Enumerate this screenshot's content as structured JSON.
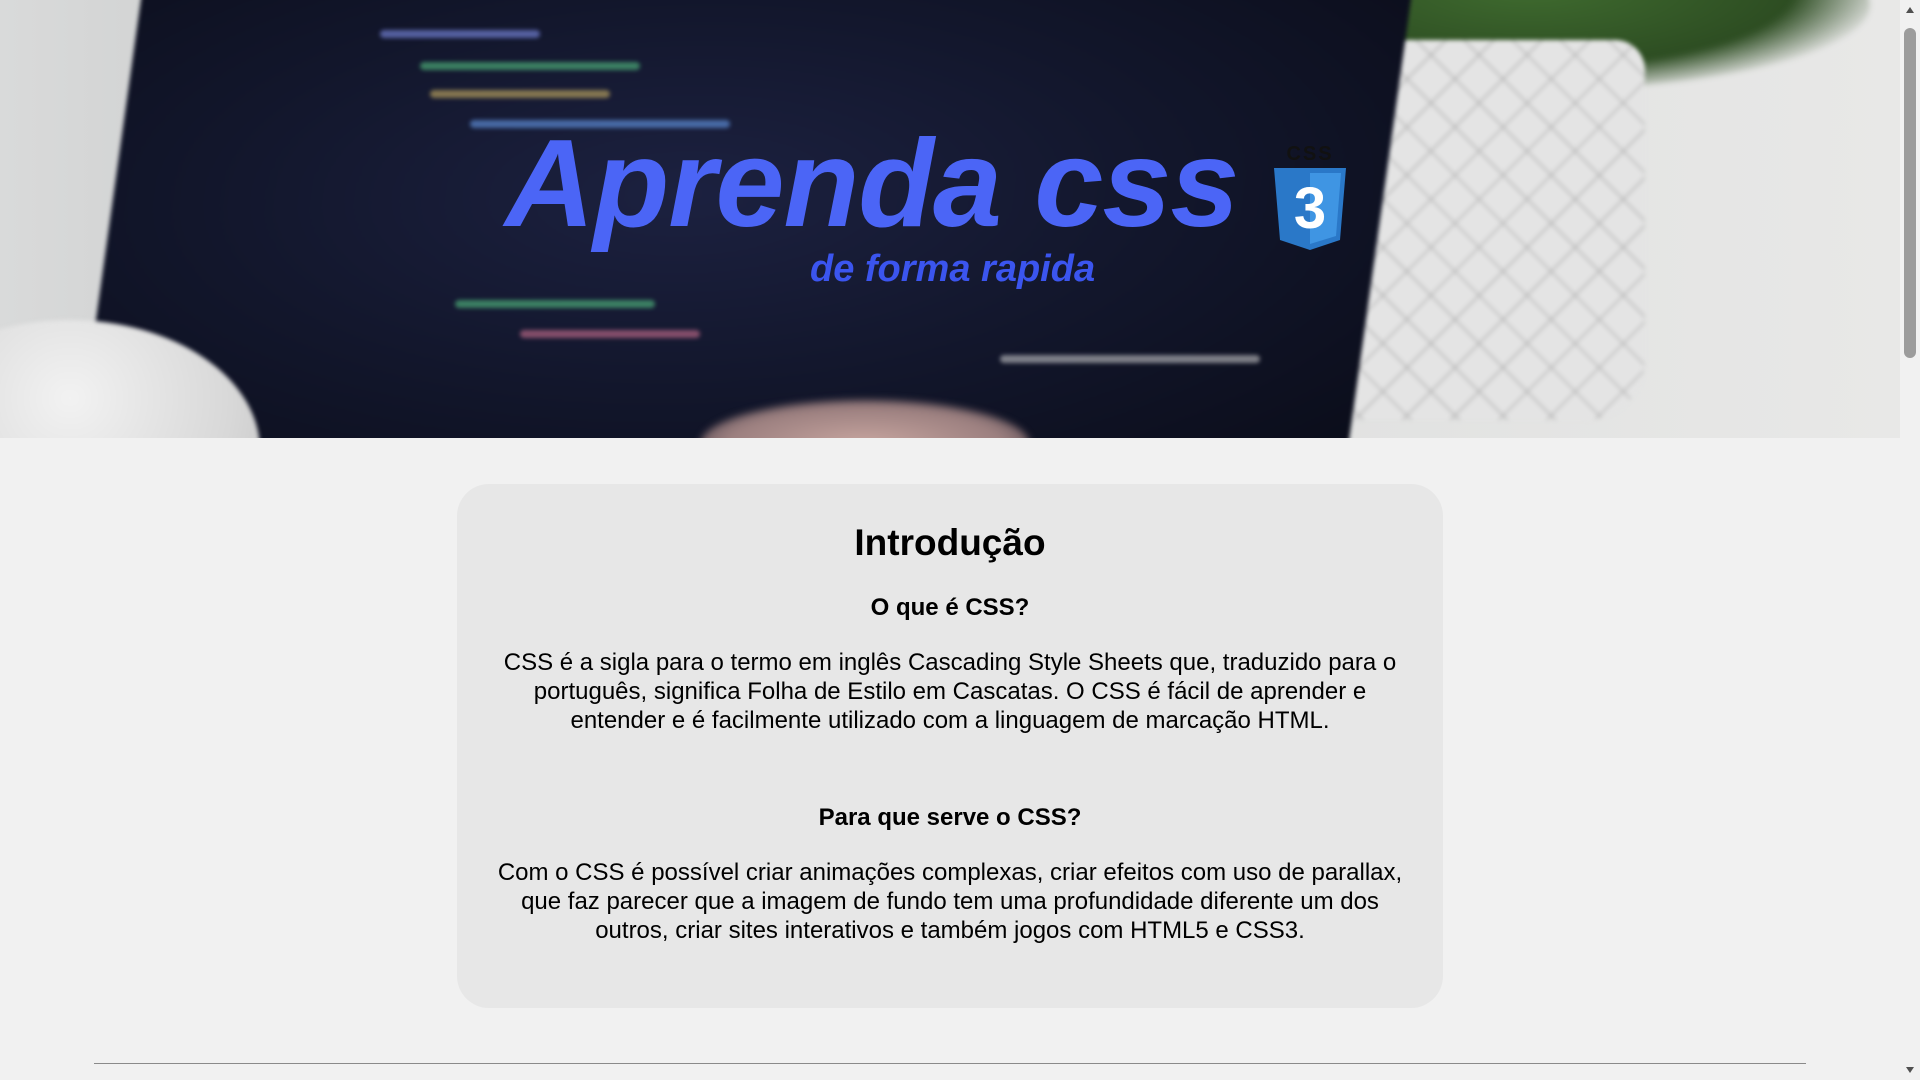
{
  "hero": {
    "title": "Aprenda css",
    "subtitle": "de forma rapida",
    "logo_text": "CSS",
    "logo_numeral": "3"
  },
  "intro": {
    "heading": "Introdução",
    "sections": [
      {
        "title": "O que é CSS?",
        "text": "CSS é a sigla para o termo em inglês Cascading Style Sheets que, traduzido para o português, significa Folha de Estilo em Cascatas. O CSS é fácil de aprender e entender e é facilmente utilizado com a linguagem de marcação HTML."
      },
      {
        "title": "Para que serve o CSS?",
        "text": "Com o CSS é possível criar animações complexas, criar efeitos com uso de parallax, que faz parecer que a imagem de fundo tem uma profundidade diferente um dos outros, criar sites interativos e também jogos com HTML5 e CSS3."
      }
    ]
  },
  "icons": {
    "logo": "css3-shield-icon",
    "scroll_up": "triangle-up-icon",
    "scroll_down": "triangle-down-icon"
  },
  "colors": {
    "title": "#4b65f6",
    "subtitle": "#3b55ef",
    "css3_shield": "#2a78c8",
    "card_bg": "#e7e7e7",
    "page_bg": "#f1f1f1"
  }
}
